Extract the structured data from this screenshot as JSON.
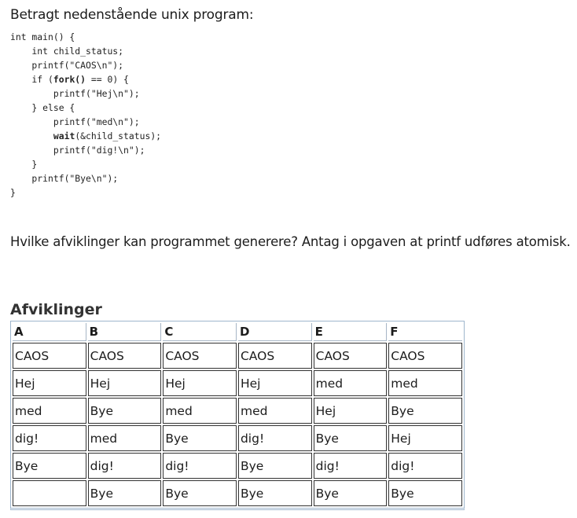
{
  "intro": "Betragt nedenstående unix program:",
  "code": {
    "lines": [
      [
        "int main() {"
      ],
      [
        "    int child_status;"
      ],
      [
        "    printf(\"CAOS\\n\");"
      ],
      [
        "    if (",
        {
          "b": "fork()"
        },
        " == 0) {"
      ],
      [
        "        printf(\"Hej\\n\");"
      ],
      [
        "    } else {"
      ],
      [
        "        printf(\"med\\n\");"
      ],
      [
        "        ",
        {
          "b": "wait"
        },
        "(&child_status);"
      ],
      [
        "        printf(\"dig!\\n\");"
      ],
      [
        "    }"
      ],
      [
        "    printf(\"Bye\\n\");"
      ],
      [
        "}"
      ]
    ]
  },
  "question": "Hvilke afviklinger kan programmet generere? Antag i opgaven at printf udføres atomisk.",
  "table": {
    "title": "Afviklinger",
    "headers": [
      "A",
      "B",
      "C",
      "D",
      "E",
      "F"
    ],
    "rows": [
      [
        "CAOS",
        "CAOS",
        "CAOS",
        "CAOS",
        "CAOS",
        "CAOS"
      ],
      [
        "Hej",
        "Hej",
        "Hej",
        "Hej",
        "med",
        "med"
      ],
      [
        "med",
        "Bye",
        "med",
        "med",
        "Hej",
        "Bye"
      ],
      [
        "dig!",
        "med",
        "Bye",
        "dig!",
        "Bye",
        "Hej"
      ],
      [
        "Bye",
        "dig!",
        "dig!",
        "Bye",
        "dig!",
        "dig!"
      ],
      [
        "",
        "Bye",
        "Bye",
        "Bye",
        "Bye",
        "Bye"
      ]
    ]
  }
}
